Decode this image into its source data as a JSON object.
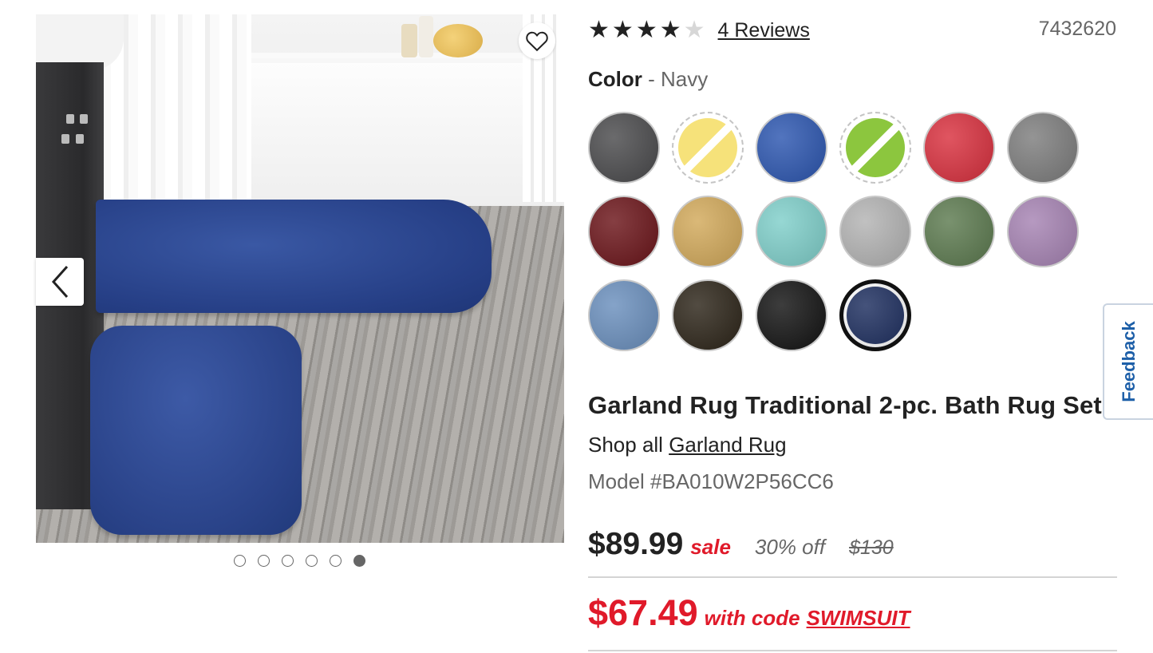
{
  "gallery": {
    "favorite_icon": "heart-outline-icon",
    "prev_icon": "chevron-left-icon",
    "dots_count": 6,
    "active_dot": 6
  },
  "rating": {
    "stars": 4,
    "max_stars": 5,
    "reviews_label": "4 Reviews"
  },
  "sku": "7432620",
  "color": {
    "label": "Color",
    "separator": " - ",
    "selected_name": "Navy",
    "swatches": [
      {
        "name": "Charcoal",
        "hex": "#4a4a4c",
        "available": true,
        "selected": false
      },
      {
        "name": "Yellow",
        "hex": "#f6e27a",
        "available": false,
        "selected": false
      },
      {
        "name": "Blue",
        "hex": "#2c56b0",
        "available": true,
        "selected": false
      },
      {
        "name": "Green",
        "hex": "#8cc63e",
        "available": false,
        "selected": false
      },
      {
        "name": "Red",
        "hex": "#d9303e",
        "available": true,
        "selected": false
      },
      {
        "name": "Gray",
        "hex": "#7d7d7d",
        "available": true,
        "selected": false
      },
      {
        "name": "Burgundy",
        "hex": "#6b1419",
        "available": true,
        "selected": false
      },
      {
        "name": "Gold",
        "hex": "#d2a95a",
        "available": true,
        "selected": false
      },
      {
        "name": "Aqua",
        "hex": "#7fcfca",
        "available": true,
        "selected": false
      },
      {
        "name": "Silver",
        "hex": "#b3b3b3",
        "available": true,
        "selected": false
      },
      {
        "name": "Sage",
        "hex": "#5c7a4f",
        "available": true,
        "selected": false
      },
      {
        "name": "Purple",
        "hex": "#a683b3",
        "available": true,
        "selected": false
      },
      {
        "name": "Denim",
        "hex": "#6a8fbd",
        "available": true,
        "selected": false
      },
      {
        "name": "Chocolate",
        "hex": "#2c2418",
        "available": true,
        "selected": false
      },
      {
        "name": "Black",
        "hex": "#121212",
        "available": true,
        "selected": false
      },
      {
        "name": "Navy",
        "hex": "#1c2d5e",
        "available": true,
        "selected": true
      }
    ]
  },
  "product": {
    "title": "Garland Rug Traditional 2-pc. Bath Rug Set",
    "shop_all_prefix": "Shop all ",
    "brand": "Garland Rug",
    "model": "Model #BA010W2P56CC6"
  },
  "pricing": {
    "sale_price": "$89.99",
    "sale_label": "sale",
    "percent_off": "30% off",
    "original_price": "$130",
    "code_price": "$67.49",
    "code_text": "with code",
    "promo_code": "SWIMSUIT",
    "accent_color": "#e01a2a"
  },
  "feedback": {
    "label": "Feedback",
    "color": "#1d5fa8"
  }
}
